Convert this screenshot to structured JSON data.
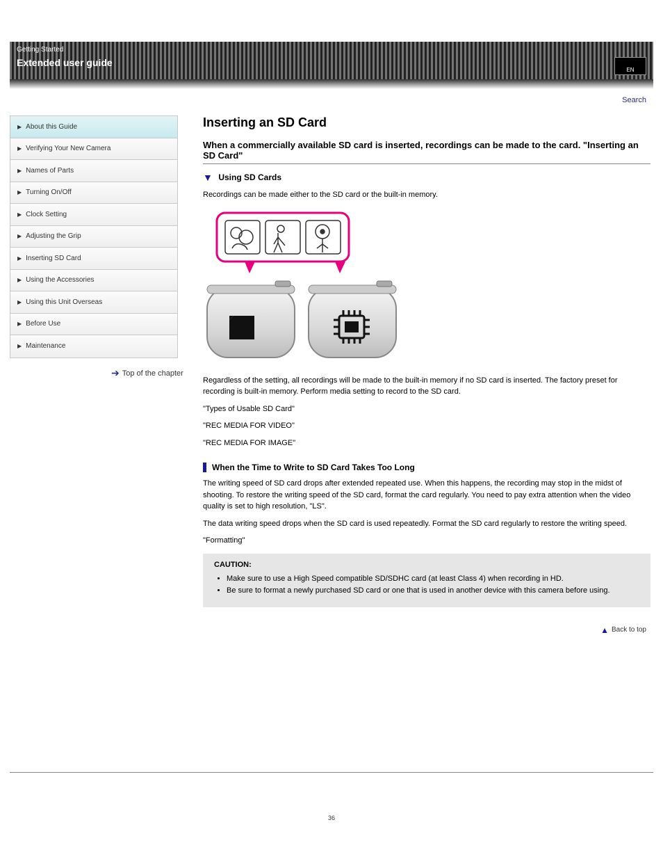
{
  "header": {
    "breadcrumb": "Getting Started",
    "title": "Extended user guide",
    "page_indicator": "EN",
    "search_label": "Search"
  },
  "sidebar": {
    "items": [
      {
        "label": "About this Guide"
      },
      {
        "label": "Verifying Your New Camera"
      },
      {
        "label": "Names of Parts"
      },
      {
        "label": "Turning On/Off"
      },
      {
        "label": "Clock Setting"
      },
      {
        "label": "Adjusting the Grip"
      },
      {
        "label": "Inserting SD Card"
      },
      {
        "label": "Using the Accessories"
      },
      {
        "label": "Using this Unit Overseas"
      },
      {
        "label": "Before Use"
      },
      {
        "label": "Maintenance"
      }
    ]
  },
  "top_link": "Top of the chapter",
  "content": {
    "title": "Inserting an SD Card",
    "para1": "When a commercially available SD card is inserted, recordings can be made to the card. &quot;Inserting an SD Card&quot;",
    "subtitle": "Using SD Cards",
    "para2": "Recordings can be made either to the SD card or the built-in memory.",
    "para3": "Regardless of the setting, all recordings will be made to the built-in memory if no SD card is inserted. The factory preset for recording is built-in memory. Perform media setting to record to the SD card.",
    "links": {
      "l1": "\"Types of Usable SD Card\"",
      "l2": "\"REC MEDIA FOR VIDEO\"",
      "l3": "\"REC MEDIA FOR IMAGE\""
    },
    "note_heading": "When the Time to Write to SD Card Takes Too Long",
    "note_para1": "The writing speed of SD card drops after extended repeated use. When this happens, the recording may stop in the midst of shooting. To restore the writing speed of the SD card, format the card regularly. You need to pay extra attention when the video quality is set to high resolution, &quot;LS&quot;.",
    "note_para2": "The data writing speed drops when the SD card is used repeatedly. Format the SD card regularly to restore the writing speed.",
    "note_link": "\"Formatting\"",
    "caution_title": "CAUTION:",
    "caution_items": [
      "Make sure to use a High Speed compatible SD/SDHC card (at least Class 4) when recording in HD.",
      "Be sure to format a newly purchased SD card or one that is used in another device with this camera before using."
    ]
  },
  "back_to_top": "Back to top",
  "page_number": "36"
}
